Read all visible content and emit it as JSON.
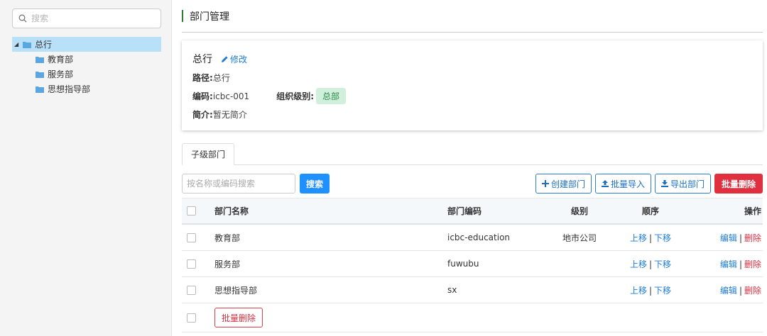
{
  "sidebar": {
    "search_placeholder": "搜索",
    "tree": {
      "root": "总行",
      "children": [
        "教育部",
        "服务部",
        "思想指导部"
      ]
    }
  },
  "page": {
    "title": "部门管理"
  },
  "detail": {
    "name": "总行",
    "edit_label": "修改",
    "path_label": "路径:",
    "path_value": "总行",
    "code_label": "编码:",
    "code_value": "icbc-001",
    "level_label": "组织级别:",
    "level_badge": "总部",
    "intro_label": "简介:",
    "intro_value": "暂无简介"
  },
  "tabs": [
    "子级部门"
  ],
  "toolbar": {
    "search_placeholder": "按名称或编码搜索",
    "search_button": "搜索",
    "create_button": "创建部门",
    "import_button": "批量导入",
    "export_button": "导出部门",
    "batch_delete_button": "批量删除"
  },
  "table": {
    "columns": [
      "部门名称",
      "部门编码",
      "级别",
      "顺序",
      "操作"
    ],
    "rows": [
      {
        "name": "教育部",
        "code": "icbc-education",
        "level": "地市公司",
        "up": "上移",
        "down": "下移",
        "edit": "编辑",
        "delete": "删除"
      },
      {
        "name": "服务部",
        "code": "fuwubu",
        "level": "",
        "up": "上移",
        "down": "下移",
        "edit": "编辑",
        "delete": "删除"
      },
      {
        "name": "思想指导部",
        "code": "sx",
        "level": "",
        "up": "上移",
        "down": "下移",
        "edit": "编辑",
        "delete": "删除"
      }
    ],
    "footer_delete": "批量删除",
    "separator": "|"
  },
  "colors": {
    "accent": "#1e90ff",
    "danger": "#e03040",
    "badge_bg": "#d1f0dc",
    "tree_selected": "#b8e0f9"
  }
}
